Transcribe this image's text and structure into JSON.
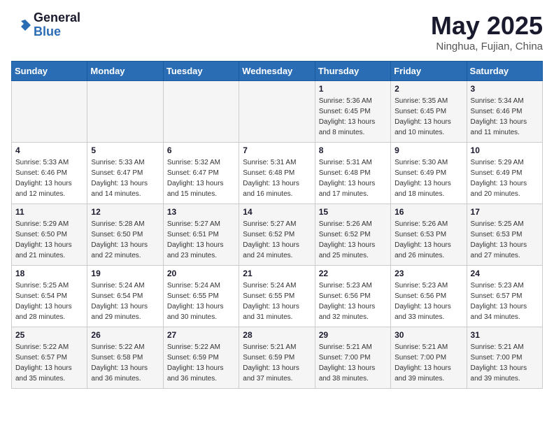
{
  "header": {
    "logo_line1": "General",
    "logo_line2": "Blue",
    "month": "May 2025",
    "location": "Ninghua, Fujian, China"
  },
  "days_of_week": [
    "Sunday",
    "Monday",
    "Tuesday",
    "Wednesday",
    "Thursday",
    "Friday",
    "Saturday"
  ],
  "weeks": [
    [
      {
        "day": "",
        "info": ""
      },
      {
        "day": "",
        "info": ""
      },
      {
        "day": "",
        "info": ""
      },
      {
        "day": "",
        "info": ""
      },
      {
        "day": "1",
        "info": "Sunrise: 5:36 AM\nSunset: 6:45 PM\nDaylight: 13 hours\nand 8 minutes."
      },
      {
        "day": "2",
        "info": "Sunrise: 5:35 AM\nSunset: 6:45 PM\nDaylight: 13 hours\nand 10 minutes."
      },
      {
        "day": "3",
        "info": "Sunrise: 5:34 AM\nSunset: 6:46 PM\nDaylight: 13 hours\nand 11 minutes."
      }
    ],
    [
      {
        "day": "4",
        "info": "Sunrise: 5:33 AM\nSunset: 6:46 PM\nDaylight: 13 hours\nand 12 minutes."
      },
      {
        "day": "5",
        "info": "Sunrise: 5:33 AM\nSunset: 6:47 PM\nDaylight: 13 hours\nand 14 minutes."
      },
      {
        "day": "6",
        "info": "Sunrise: 5:32 AM\nSunset: 6:47 PM\nDaylight: 13 hours\nand 15 minutes."
      },
      {
        "day": "7",
        "info": "Sunrise: 5:31 AM\nSunset: 6:48 PM\nDaylight: 13 hours\nand 16 minutes."
      },
      {
        "day": "8",
        "info": "Sunrise: 5:31 AM\nSunset: 6:48 PM\nDaylight: 13 hours\nand 17 minutes."
      },
      {
        "day": "9",
        "info": "Sunrise: 5:30 AM\nSunset: 6:49 PM\nDaylight: 13 hours\nand 18 minutes."
      },
      {
        "day": "10",
        "info": "Sunrise: 5:29 AM\nSunset: 6:49 PM\nDaylight: 13 hours\nand 20 minutes."
      }
    ],
    [
      {
        "day": "11",
        "info": "Sunrise: 5:29 AM\nSunset: 6:50 PM\nDaylight: 13 hours\nand 21 minutes."
      },
      {
        "day": "12",
        "info": "Sunrise: 5:28 AM\nSunset: 6:50 PM\nDaylight: 13 hours\nand 22 minutes."
      },
      {
        "day": "13",
        "info": "Sunrise: 5:27 AM\nSunset: 6:51 PM\nDaylight: 13 hours\nand 23 minutes."
      },
      {
        "day": "14",
        "info": "Sunrise: 5:27 AM\nSunset: 6:52 PM\nDaylight: 13 hours\nand 24 minutes."
      },
      {
        "day": "15",
        "info": "Sunrise: 5:26 AM\nSunset: 6:52 PM\nDaylight: 13 hours\nand 25 minutes."
      },
      {
        "day": "16",
        "info": "Sunrise: 5:26 AM\nSunset: 6:53 PM\nDaylight: 13 hours\nand 26 minutes."
      },
      {
        "day": "17",
        "info": "Sunrise: 5:25 AM\nSunset: 6:53 PM\nDaylight: 13 hours\nand 27 minutes."
      }
    ],
    [
      {
        "day": "18",
        "info": "Sunrise: 5:25 AM\nSunset: 6:54 PM\nDaylight: 13 hours\nand 28 minutes."
      },
      {
        "day": "19",
        "info": "Sunrise: 5:24 AM\nSunset: 6:54 PM\nDaylight: 13 hours\nand 29 minutes."
      },
      {
        "day": "20",
        "info": "Sunrise: 5:24 AM\nSunset: 6:55 PM\nDaylight: 13 hours\nand 30 minutes."
      },
      {
        "day": "21",
        "info": "Sunrise: 5:24 AM\nSunset: 6:55 PM\nDaylight: 13 hours\nand 31 minutes."
      },
      {
        "day": "22",
        "info": "Sunrise: 5:23 AM\nSunset: 6:56 PM\nDaylight: 13 hours\nand 32 minutes."
      },
      {
        "day": "23",
        "info": "Sunrise: 5:23 AM\nSunset: 6:56 PM\nDaylight: 13 hours\nand 33 minutes."
      },
      {
        "day": "24",
        "info": "Sunrise: 5:23 AM\nSunset: 6:57 PM\nDaylight: 13 hours\nand 34 minutes."
      }
    ],
    [
      {
        "day": "25",
        "info": "Sunrise: 5:22 AM\nSunset: 6:57 PM\nDaylight: 13 hours\nand 35 minutes."
      },
      {
        "day": "26",
        "info": "Sunrise: 5:22 AM\nSunset: 6:58 PM\nDaylight: 13 hours\nand 36 minutes."
      },
      {
        "day": "27",
        "info": "Sunrise: 5:22 AM\nSunset: 6:59 PM\nDaylight: 13 hours\nand 36 minutes."
      },
      {
        "day": "28",
        "info": "Sunrise: 5:21 AM\nSunset: 6:59 PM\nDaylight: 13 hours\nand 37 minutes."
      },
      {
        "day": "29",
        "info": "Sunrise: 5:21 AM\nSunset: 7:00 PM\nDaylight: 13 hours\nand 38 minutes."
      },
      {
        "day": "30",
        "info": "Sunrise: 5:21 AM\nSunset: 7:00 PM\nDaylight: 13 hours\nand 39 minutes."
      },
      {
        "day": "31",
        "info": "Sunrise: 5:21 AM\nSunset: 7:00 PM\nDaylight: 13 hours\nand 39 minutes."
      }
    ]
  ]
}
